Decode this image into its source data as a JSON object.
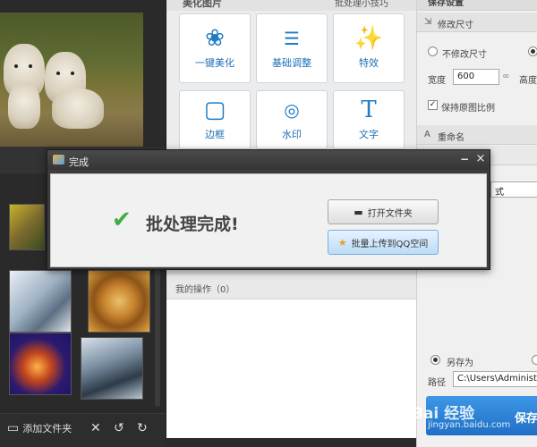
{
  "left": {
    "toolbar": {
      "add_folder_label": "添加文件夹",
      "add_folder_icon": "folder-icon",
      "delete_icon": "close-icon",
      "rotate_left_icon": "rotate-left-icon",
      "rotate_right_icon": "rotate-right-icon"
    },
    "thumbnails": [
      "dog-thumb",
      "glass-thumb",
      "wheel-thumb",
      "anvil-thumb",
      "gears-thumb"
    ]
  },
  "middle": {
    "title": "美化图片",
    "batch_link": "批处理小技巧",
    "tools": [
      {
        "label": "一键美化",
        "icon": "tulip-icon"
      },
      {
        "label": "基础调整",
        "icon": "sliders-icon"
      },
      {
        "label": "特效",
        "icon": "magic-wand-icon"
      },
      {
        "label": "边框",
        "icon": "frame-icon"
      },
      {
        "label": "水印",
        "icon": "watermark-icon"
      },
      {
        "label": "文字",
        "icon": "text-icon"
      }
    ],
    "ops_label": "我的操作（0）"
  },
  "right": {
    "title": "保存设置",
    "resize_section": "修改尺寸",
    "no_resize_label": "不修改尺寸",
    "width_label": "宽度",
    "width_value": "600",
    "height_label": "高度",
    "keep_ratio_label": "保持原图比例",
    "rename_section": "重命名",
    "format_value": "式",
    "save_as_label": "另存为",
    "path_label": "路径",
    "path_value": "C:\\Users\\Administrat",
    "save_button": "保存"
  },
  "dialog": {
    "title": "完成",
    "minimize": "−",
    "close": "×",
    "message": "批处理完成!",
    "open_folder": "打开文件夹",
    "upload_qzone": "批量上传到QQ空间"
  },
  "watermark": {
    "text": "Bai 经验",
    "sub": "jingyan.baidu.com"
  },
  "colors": {
    "accent_blue": "#1f7bc2",
    "success_green": "#3cb043",
    "dark_bg": "#2a2a2a"
  }
}
